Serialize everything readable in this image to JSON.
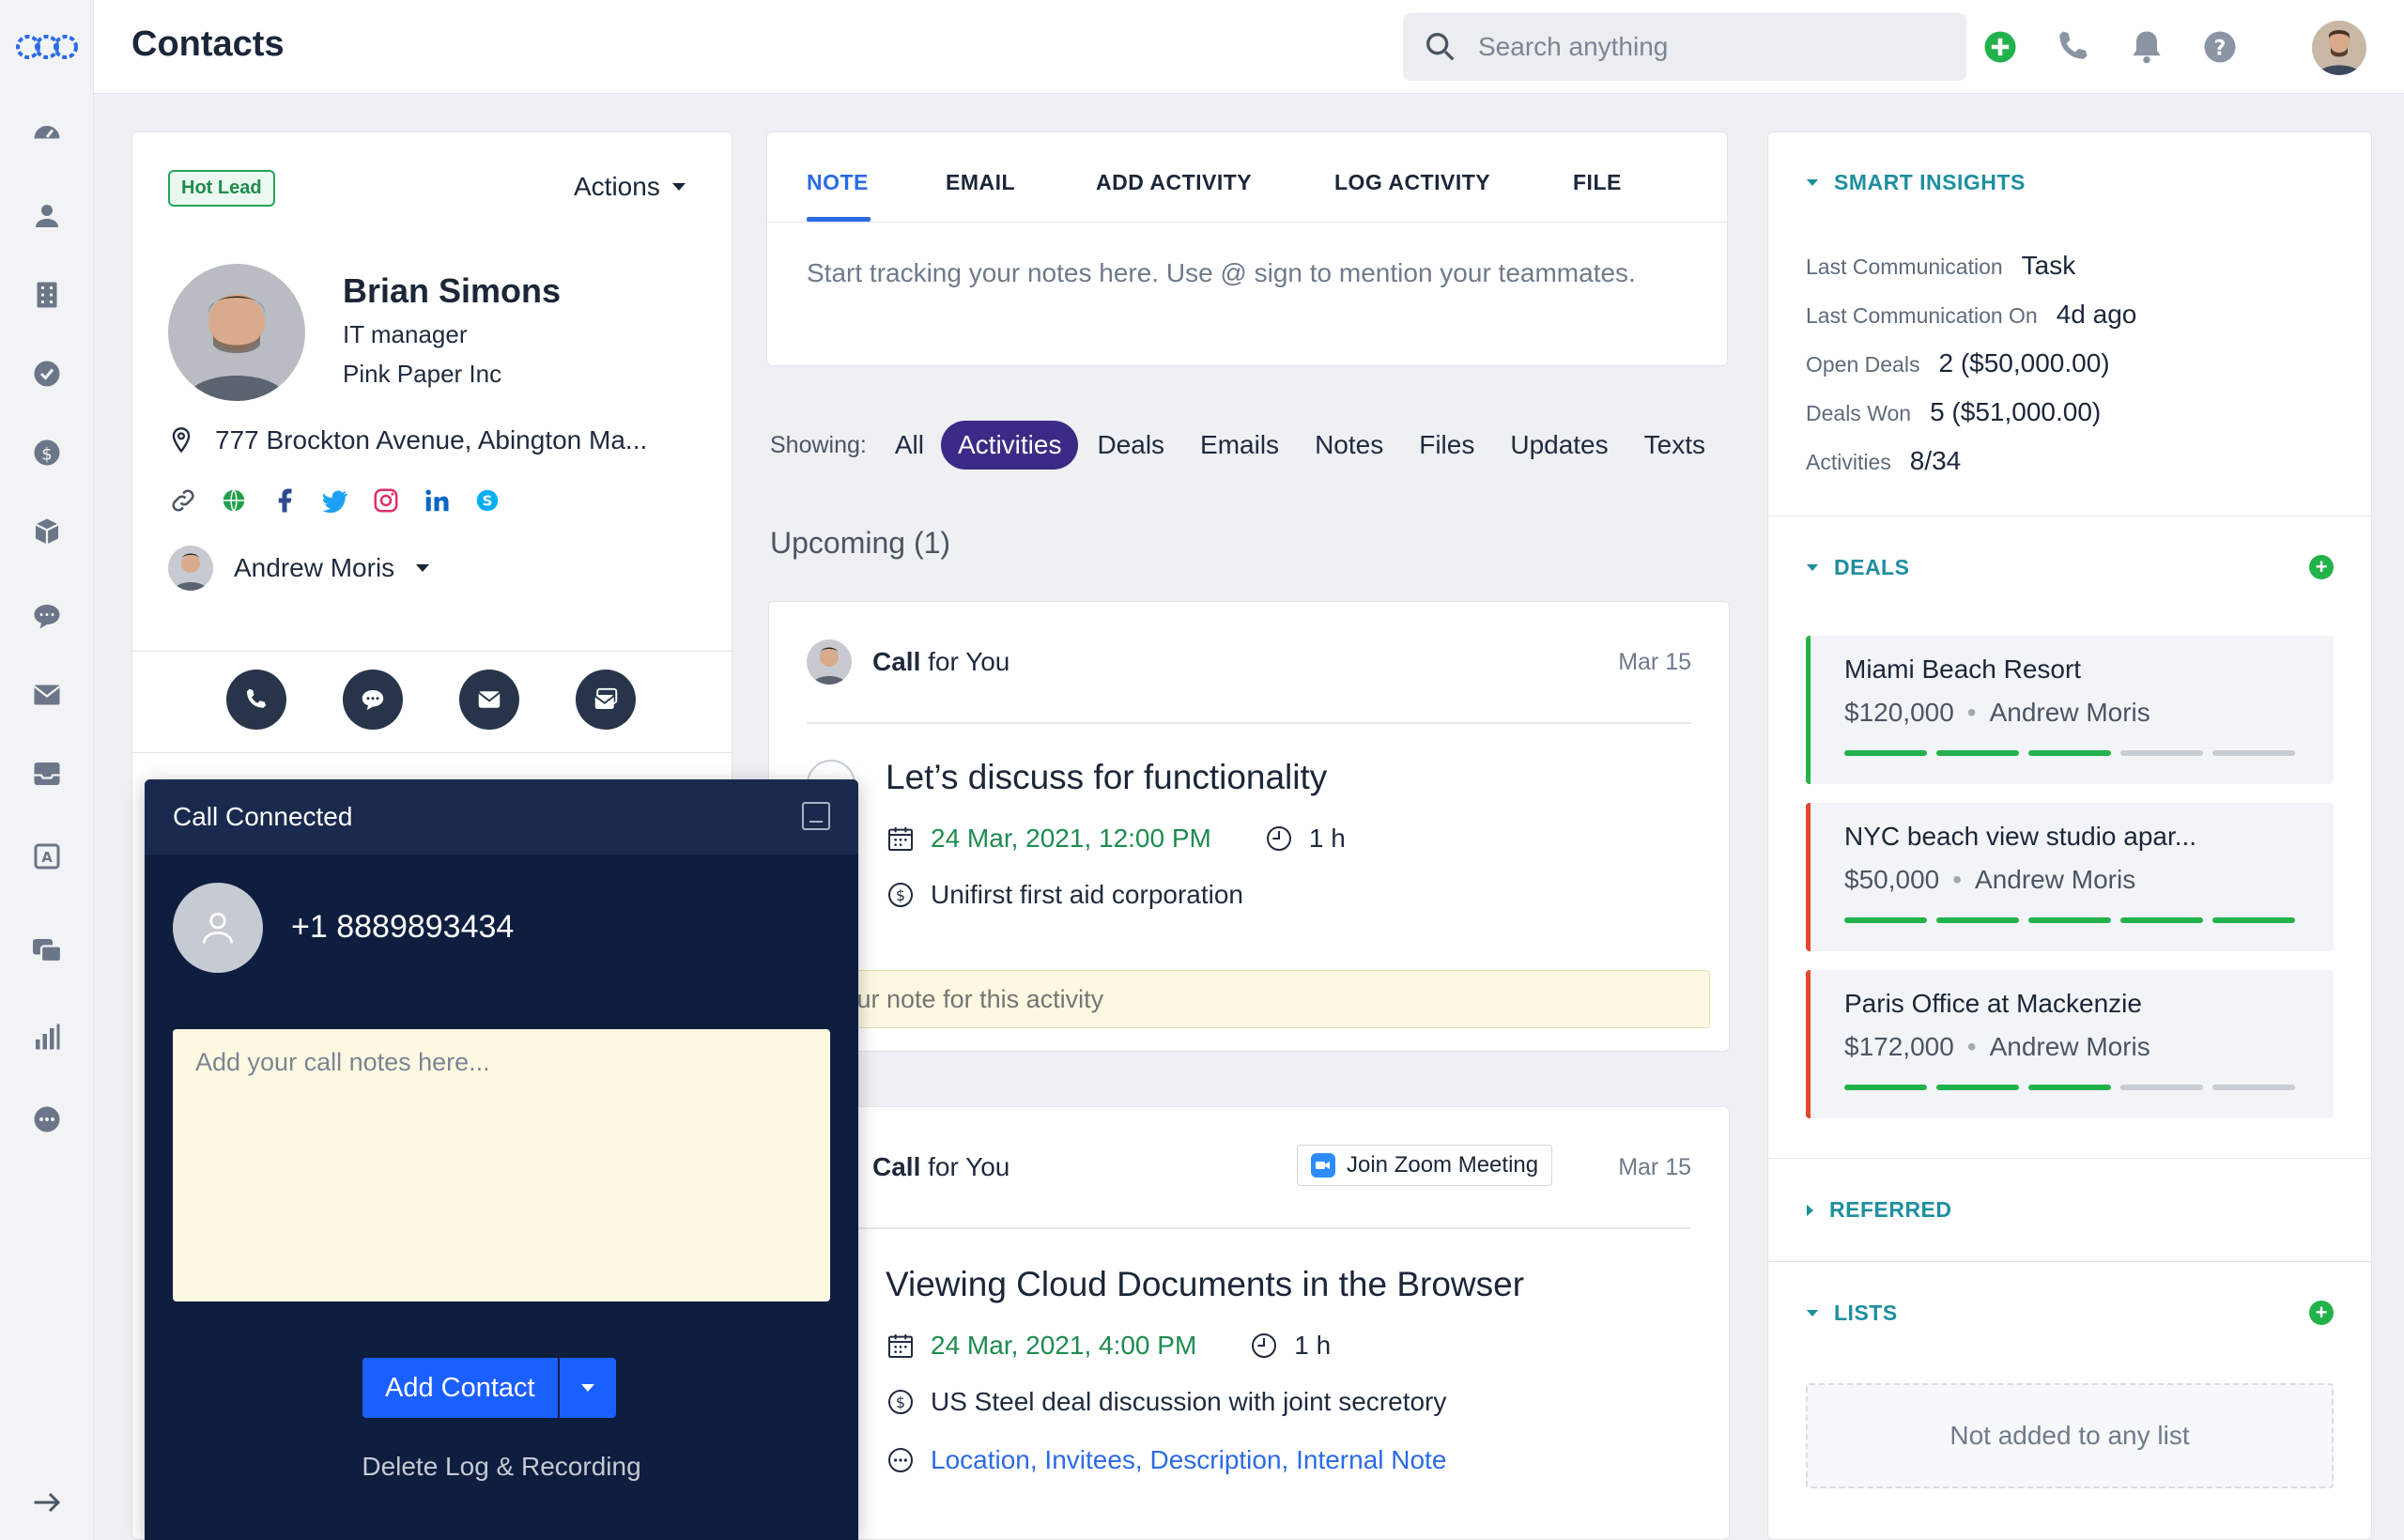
{
  "header": {
    "title": "Contacts",
    "search_placeholder": "Search anything"
  },
  "contact": {
    "badge": "Hot Lead",
    "actions_label": "Actions",
    "name": "Brian Simons",
    "role": "IT manager",
    "company": "Pink Paper Inc",
    "address": "777 Brockton Avenue, Abington Ma...",
    "owner": "Andrew Moris"
  },
  "call": {
    "status": "Call Connected",
    "number": "+1 8889893434",
    "notes_placeholder": "Add your call notes here...",
    "add_contact_label": "Add Contact",
    "delete_label": "Delete Log & Recording"
  },
  "composer": {
    "tabs": [
      "NOTE",
      "EMAIL",
      "ADD ACTIVITY",
      "LOG ACTIVITY",
      "FILE"
    ],
    "active_tab": "NOTE",
    "placeholder": "Start tracking your notes here. Use @ sign to mention your teammates."
  },
  "filters": {
    "label": "Showing:",
    "items": [
      "All",
      "Activities",
      "Deals",
      "Emails",
      "Notes",
      "Files",
      "Updates",
      "Texts"
    ],
    "active": "Activities"
  },
  "timeline": {
    "section": "Upcoming (1)",
    "activities": [
      {
        "who_prefix": "Call",
        "who_suffix": "for You",
        "date": "Mar 15",
        "title": "Let’s discuss for functionality",
        "datetime": "24 Mar, 2021, 12:00 PM",
        "duration": "1 h",
        "deal": "Unifirst first aid corporation",
        "note_placeholder": "your note for this activity"
      },
      {
        "who_prefix": "Call",
        "who_suffix": "for You",
        "zoom_label": "Join Zoom Meeting",
        "date": "Mar 15",
        "title": "Viewing Cloud Documents in the Browser",
        "datetime": "24 Mar, 2021, 4:00 PM",
        "duration": "1 h",
        "deal": "US Steel deal discussion with joint secretory",
        "more": "Location, Invitees, Description, Internal Note"
      }
    ]
  },
  "insights": {
    "title": "SMART INSIGHTS",
    "rows": [
      {
        "k": "Last Communication",
        "v": "Task"
      },
      {
        "k": "Last Communication On",
        "v": "4d ago"
      },
      {
        "k": "Open Deals",
        "v": "2 ($50,000.00)"
      },
      {
        "k": "Deals Won",
        "v": "5 ($51,000.00)"
      },
      {
        "k": "Activities",
        "v": "8/34"
      }
    ]
  },
  "deals": {
    "title": "DEALS",
    "items": [
      {
        "name": "Miami Beach Resort",
        "amount": "$120,000",
        "owner": "Andrew Moris",
        "stages_done": 3,
        "stages_total": 5,
        "status_color": "#22b24c"
      },
      {
        "name": "NYC beach view studio apar...",
        "amount": "$50,000",
        "owner": "Andrew Moris",
        "stages_done": 5,
        "stages_total": 5,
        "status_color": "#e4462b"
      },
      {
        "name": "Paris Office at Mackenzie",
        "amount": "$172,000",
        "owner": "Andrew Moris",
        "stages_done": 3,
        "stages_total": 5,
        "status_color": "#e4462b"
      }
    ]
  },
  "referred": {
    "title": "REFERRED"
  },
  "lists": {
    "title": "LISTS",
    "empty": "Not added to any list"
  },
  "colors": {
    "accent": "#2b6be5",
    "teal": "#1d8fa0",
    "green": "#22b24c",
    "call_bg": "#0f1d3f",
    "pill": "#3c2b86"
  }
}
